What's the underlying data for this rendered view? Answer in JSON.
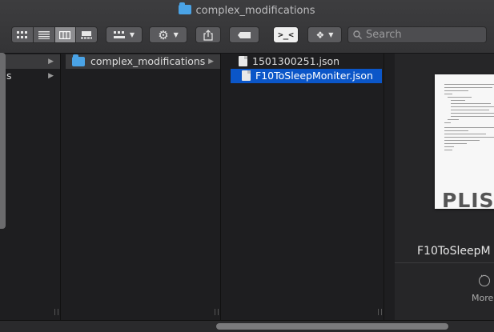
{
  "window": {
    "title": "complex_modifications"
  },
  "toolbar": {
    "view_icons": [
      "icon-view-icon",
      "list-view-icon",
      "column-view-icon",
      "gallery-view-icon"
    ],
    "group_icon": "group-icon",
    "action_icon": "gear-icon",
    "share_icon": "share-icon",
    "tag_icon": "tag-icon",
    "terminal_icon": "terminal-icon",
    "dropbox_icon": "dropbox-icon",
    "search_placeholder": "Search"
  },
  "columns": {
    "col0": {
      "rows": [
        {
          "label": "",
          "has_children": true
        },
        {
          "label": "s",
          "has_children": true
        }
      ]
    },
    "col1": {
      "rows": [
        {
          "label": "complex_modifications",
          "icon": "folder-icon",
          "has_children": true
        }
      ]
    },
    "col2": {
      "rows": [
        {
          "label": "1501300251.json",
          "icon": "json-file-icon"
        },
        {
          "label": "F10ToSleepMoniter.json",
          "icon": "json-file-icon",
          "selected": true
        }
      ]
    }
  },
  "preview": {
    "thumbnail_label": "PLIST",
    "filename": "F10ToSleepM",
    "more_label": "More"
  },
  "colors": {
    "selection_blue": "#0b56c8",
    "folder_blue": "#4aa3e6"
  }
}
